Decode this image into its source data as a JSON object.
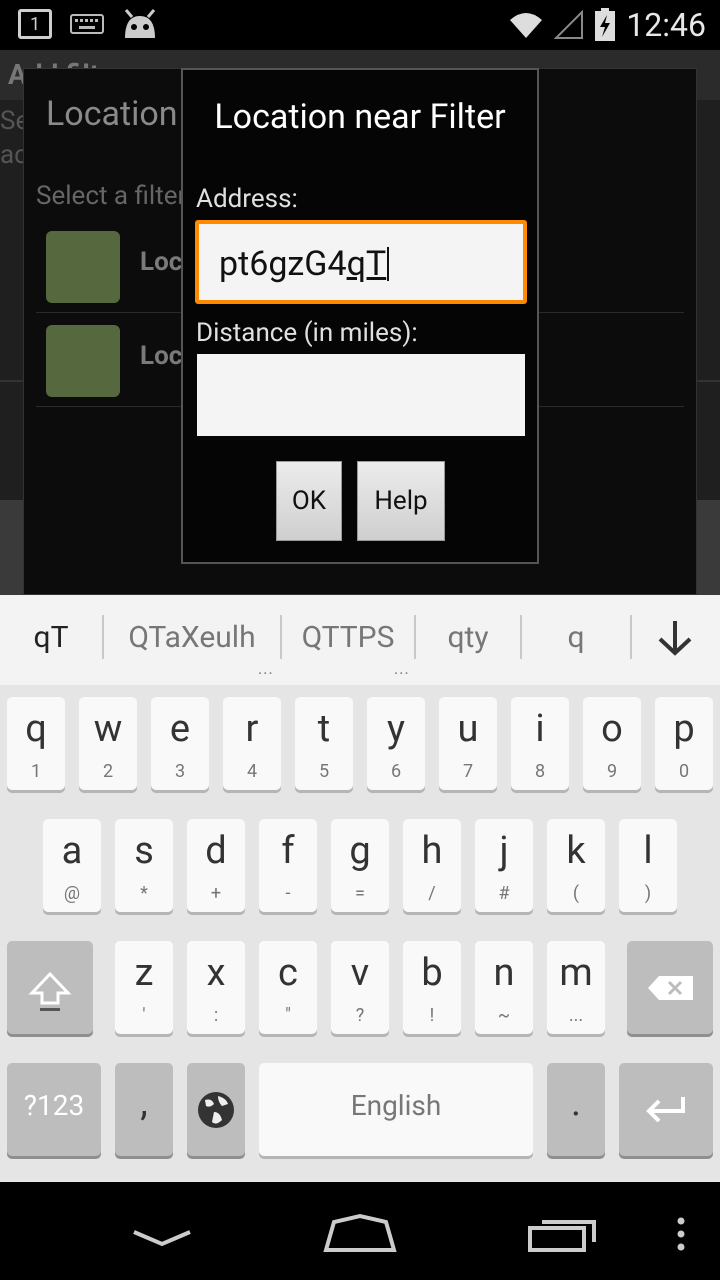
{
  "status_bar": {
    "notification_count": "1",
    "time": "12:46",
    "icons": [
      "notification-badge-icon",
      "keyboard-icon",
      "android-robot-icon",
      "wifi-icon",
      "cell-signal-icon",
      "battery-charging-icon"
    ]
  },
  "background_app": {
    "title": "Add filter",
    "line1": "Se",
    "line2": "ac"
  },
  "back_dialog": {
    "title": "Location",
    "subtitle": "Select a filter to add to [Location]:",
    "rows": [
      {
        "label": "Loca"
      },
      {
        "label": "Loca"
      }
    ]
  },
  "dialog": {
    "title": "Location near Filter",
    "address_label": "Address:",
    "address_value_plain": "pt6gzG4",
    "address_value_composing": "qT",
    "distance_label": "Distance (in miles):",
    "distance_value": "",
    "ok_label": "OK",
    "help_label": "Help"
  },
  "suggestions": {
    "items": [
      "qT",
      "QTaXeulh",
      "QTTPS",
      "qty",
      "q"
    ],
    "more_dots": "...",
    "collapse_icon": "arrow-down-icon"
  },
  "keyboard": {
    "row1": [
      {
        "m": "q",
        "h": "1"
      },
      {
        "m": "w",
        "h": "2"
      },
      {
        "m": "e",
        "h": "3"
      },
      {
        "m": "r",
        "h": "4"
      },
      {
        "m": "t",
        "h": "5"
      },
      {
        "m": "y",
        "h": "6"
      },
      {
        "m": "u",
        "h": "7"
      },
      {
        "m": "i",
        "h": "8"
      },
      {
        "m": "o",
        "h": "9"
      },
      {
        "m": "p",
        "h": "0"
      }
    ],
    "row2": [
      {
        "m": "a",
        "h": "@"
      },
      {
        "m": "s",
        "h": "*"
      },
      {
        "m": "d",
        "h": "+"
      },
      {
        "m": "f",
        "h": "-"
      },
      {
        "m": "g",
        "h": "="
      },
      {
        "m": "h",
        "h": "/"
      },
      {
        "m": "j",
        "h": "#"
      },
      {
        "m": "k",
        "h": "("
      },
      {
        "m": "l",
        "h": ")"
      }
    ],
    "row3": [
      {
        "m": "z",
        "h": "'"
      },
      {
        "m": "x",
        "h": ":"
      },
      {
        "m": "c",
        "h": "\""
      },
      {
        "m": "v",
        "h": "?"
      },
      {
        "m": "b",
        "h": "!"
      },
      {
        "m": "n",
        "h": "~"
      },
      {
        "m": "m",
        "h": "..."
      }
    ],
    "symbols_label": "?123",
    "comma": ",",
    "space_label": "English",
    "period": ".",
    "shift_icon": "shift-icon",
    "backspace_icon": "backspace-icon",
    "globe_icon": "globe-icon",
    "enter_icon": "enter-icon"
  },
  "nav_bar": {
    "icons": [
      "back-icon",
      "home-icon",
      "recents-icon",
      "menu-icon"
    ]
  }
}
